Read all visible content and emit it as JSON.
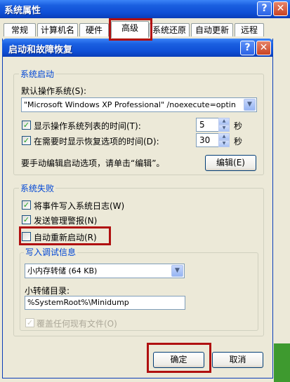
{
  "back_window": {
    "title": "系统属性",
    "help": "?",
    "close": "✕",
    "tabs": [
      "常规",
      "计算机名",
      "硬件",
      "高级",
      "系统还原",
      "自动更新",
      "远程"
    ]
  },
  "dialog": {
    "title": "启动和故障恢复",
    "help": "?",
    "close": "✕",
    "startup": {
      "group_label": "系统启动",
      "default_os_label": "默认操作系统(S):",
      "default_os_value": "\"Microsoft Windows XP Professional\" /noexecute=optin",
      "show_list_label": "显示操作系统列表的时间(T):",
      "show_list_checked": true,
      "show_list_value": "5",
      "show_recovery_label": "在需要时显示恢复选项的时间(D):",
      "show_recovery_checked": true,
      "show_recovery_value": "30",
      "unit": "秒",
      "edit_hint": "要手动编辑启动选项，请单击“编辑”。",
      "edit_button": "编辑(E)"
    },
    "failure": {
      "group_label": "系统失败",
      "write_event_label": "将事件写入系统日志(W)",
      "write_event_checked": true,
      "send_alert_label": "发送管理警报(N)",
      "send_alert_checked": true,
      "auto_restart_label": "自动重新启动(R)",
      "auto_restart_checked": false,
      "debug": {
        "group_label": "写入调试信息",
        "type_value": "小内存转储 (64 KB)",
        "dir_label": "小转储目录:",
        "dir_value": "%SystemRoot%\\Minidump",
        "overwrite_label": "覆盖任何现有文件(O)",
        "overwrite_checked": true
      }
    },
    "ok_button": "确定",
    "cancel_button": "取消"
  },
  "colors": {
    "highlight_box": "#B01010",
    "titlebar": "#0F4FD6",
    "group_label": "#0046D5"
  }
}
